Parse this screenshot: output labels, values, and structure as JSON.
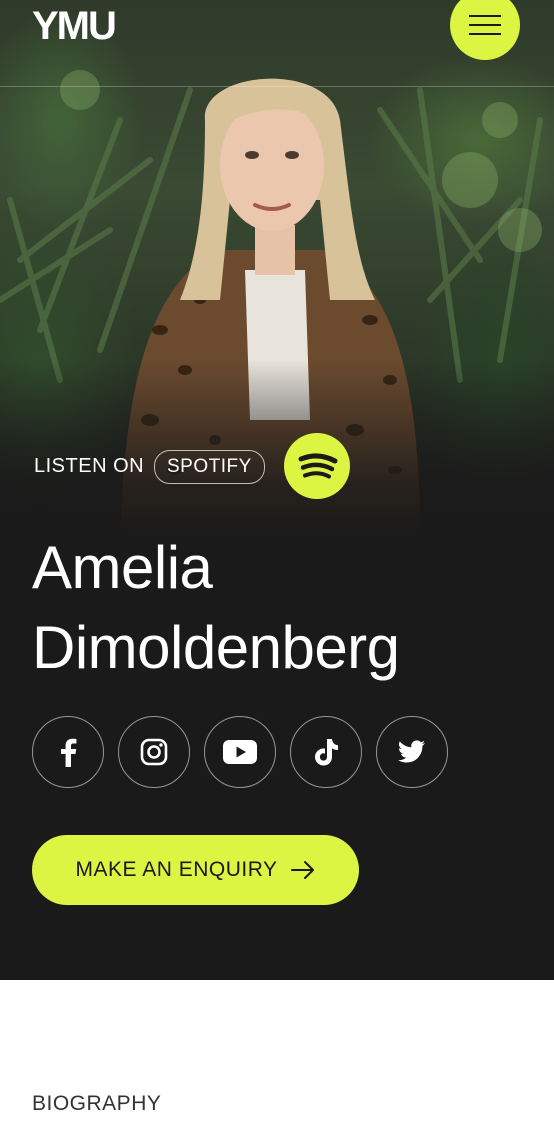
{
  "header": {
    "logo": "YMU",
    "menu_icon": "hamburger-menu-icon"
  },
  "hero": {
    "listen_on": "LISTEN ON",
    "spotify_label": "SPOTIFY",
    "spotify_icon": "spotify-icon",
    "name_line1": "Amelia",
    "name_line2": "Dimoldenberg",
    "socials": [
      {
        "name": "facebook-icon"
      },
      {
        "name": "instagram-icon"
      },
      {
        "name": "youtube-icon"
      },
      {
        "name": "tiktok-icon"
      },
      {
        "name": "twitter-icon"
      }
    ],
    "enquiry_label": "MAKE AN ENQUIRY",
    "enquiry_icon": "arrow-right-icon"
  },
  "sections": {
    "biography_label": "BIOGRAPHY"
  },
  "colors": {
    "accent": "#dcf542",
    "dark_bg": "#1a1a1a",
    "text_light": "#ffffff"
  }
}
